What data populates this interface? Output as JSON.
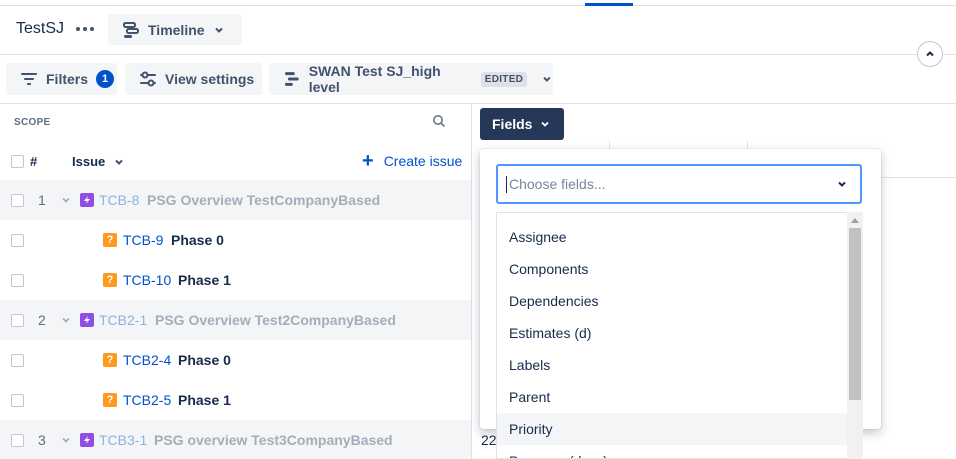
{
  "header": {
    "project": "TestSJ",
    "view_label": "Timeline"
  },
  "toolbar": {
    "filters_label": "Filters",
    "filters_count": "1",
    "view_settings_label": "View settings",
    "plan_name": "SWAN Test SJ_high level",
    "plan_badge": "EDITED"
  },
  "scope": {
    "title": "SCOPE",
    "hash_header": "#",
    "issue_header": "Issue",
    "create_issue": "Create issue",
    "rows": [
      {
        "num": "1",
        "key": "TCB-8",
        "summary": "PSG Overview TestCompanyBased"
      },
      {
        "key": "TCB-9",
        "summary": "Phase 0"
      },
      {
        "key": "TCB-10",
        "summary": "Phase 1"
      },
      {
        "num": "2",
        "key": "TCB2-1",
        "summary": "PSG Overview Test2CompanyBased"
      },
      {
        "key": "TCB2-4",
        "summary": "Phase 0"
      },
      {
        "key": "TCB2-5",
        "summary": "Phase 1"
      },
      {
        "num": "3",
        "key": "TCB3-1",
        "summary": "PSG overview Test3CompanyBased"
      }
    ]
  },
  "fields": {
    "button_label": "Fields",
    "placeholder": "Choose fields...",
    "options": [
      "Assignee",
      "Components",
      "Dependencies",
      "Estimates (d)",
      "Labels",
      "Parent",
      "Priority",
      "Progress (days)"
    ],
    "behind_value": "22"
  },
  "colors": {
    "primary": "#0052cc",
    "fields_button": "#253858",
    "epic": "#904ee2",
    "question": "#ff991f",
    "focus": "#4c9aff"
  }
}
